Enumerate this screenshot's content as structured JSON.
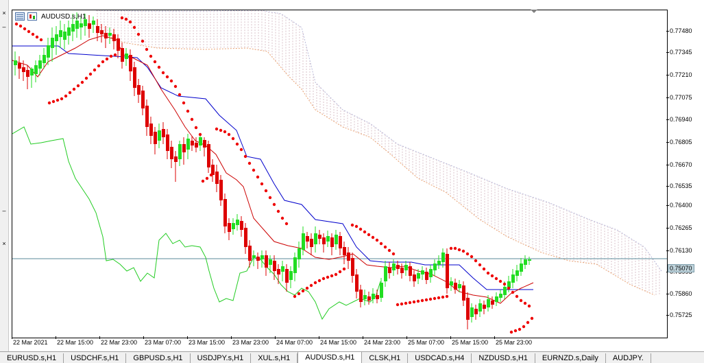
{
  "chart": {
    "symbol": "AUDUSD.s,H1",
    "current_price": "0.75070",
    "price_labels": [
      "0.77480",
      "0.77345",
      "0.77210",
      "0.77075",
      "0.76940",
      "0.76805",
      "0.76670",
      "0.76535",
      "0.76400",
      "0.76265",
      "0.76130",
      "0.75995",
      "0.75860",
      "0.75725"
    ],
    "time_labels": [
      "22 Mar 2021",
      "22 Mar 15:00",
      "22 Mar 23:00",
      "23 Mar 07:00",
      "23 Mar 15:00",
      "23 Mar 23:00",
      "24 Mar 07:00",
      "24 Mar 15:00",
      "24 Mar 23:00",
      "25 Mar 07:00",
      "25 Mar 15:00",
      "25 Mar 23:00"
    ],
    "icons": [
      "grid-icon",
      "candles-icon"
    ]
  },
  "tabs": [
    {
      "label": "EURUSD.s,H1",
      "active": false
    },
    {
      "label": "USDCHF.s,H1",
      "active": false
    },
    {
      "label": "GBPUSD.s,H1",
      "active": false
    },
    {
      "label": "USDJPY.s,H1",
      "active": false
    },
    {
      "label": "XUL.s,H1",
      "active": false
    },
    {
      "label": "AUDUSD.s,H1",
      "active": true
    },
    {
      "label": "CLSK,H1",
      "active": false
    },
    {
      "label": "USDCAD.s,H4",
      "active": false
    },
    {
      "label": "NZDUSD.s,H1",
      "active": false
    },
    {
      "label": "EURNZD.s,Daily",
      "active": false
    },
    {
      "label": "AUDJPY.",
      "active": false
    }
  ],
  "colors": {
    "bull": "#22dd22",
    "bear": "#dd0000",
    "sar": "#ee0000",
    "kijun": "#0000cc",
    "tenkan": "#cc0000",
    "chikou": "#22cc22",
    "cloud_a": "#e8a070",
    "cloud_b": "#b8b8d8",
    "price_line": "#5a8a9a"
  }
}
